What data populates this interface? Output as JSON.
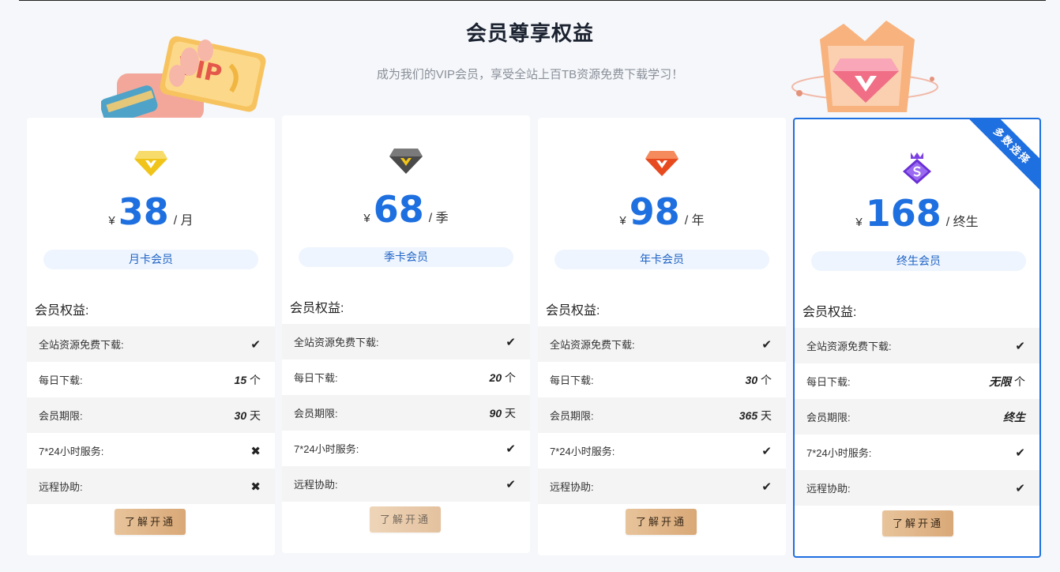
{
  "header": {
    "title": "会员尊享权益",
    "subtitle": "成为我们的VIP会员，享受全站上百TB资源免费下载学习！"
  },
  "deco": {
    "vip_text": "VIP"
  },
  "benefits_title": "会员权益:",
  "row_labels": [
    "全站资源免费下载:",
    "每日下载:",
    "会员期限:",
    "7*24小时服务:",
    "远程协助:"
  ],
  "plans": [
    {
      "gem_color": "#f0c419",
      "currency": "¥",
      "amount": "38",
      "unit": "/ 月",
      "name": "月卡会员",
      "rows": [
        {
          "icon": "check-icon"
        },
        {
          "value": "15",
          "unit": " 个"
        },
        {
          "value": "30",
          "unit": " 天"
        },
        {
          "icon": "cross-icon"
        },
        {
          "icon": "cross-icon"
        }
      ],
      "button": "了解开通"
    },
    {
      "gem_color": "#5a5a5a",
      "currency": "¥",
      "amount": "68",
      "unit": "/ 季",
      "name": "季卡会员",
      "rows": [
        {
          "icon": "check-icon"
        },
        {
          "value": "20",
          "unit": " 个"
        },
        {
          "value": "90",
          "unit": " 天"
        },
        {
          "icon": "check-icon"
        },
        {
          "icon": "check-icon"
        }
      ],
      "button": "了解开通"
    },
    {
      "gem_color": "#f0552a",
      "currency": "¥",
      "amount": "98",
      "unit": "/ 年",
      "name": "年卡会员",
      "rows": [
        {
          "icon": "check-icon"
        },
        {
          "value": "30",
          "unit": " 个"
        },
        {
          "value": "365",
          "unit": " 天"
        },
        {
          "icon": "check-icon"
        },
        {
          "icon": "check-icon"
        }
      ],
      "button": "了解开通"
    },
    {
      "gem_color": "#7b3fe4",
      "currency": "¥",
      "amount": "168",
      "unit": "/ 终生",
      "name": "终生会员",
      "ribbon": "多数选择",
      "rows": [
        {
          "icon": "check-icon"
        },
        {
          "value": "无限",
          "unit": " 个"
        },
        {
          "value": "终生",
          "unit": ""
        },
        {
          "icon": "check-icon"
        },
        {
          "icon": "check-icon"
        }
      ],
      "button": "了解开通"
    }
  ],
  "colors": {
    "accent": "#1e6fe0",
    "button_gold": "#d9a877",
    "pill_bg": "#eef5fe"
  },
  "glyphs": {
    "check-icon": "✔",
    "cross-icon": "✖"
  }
}
